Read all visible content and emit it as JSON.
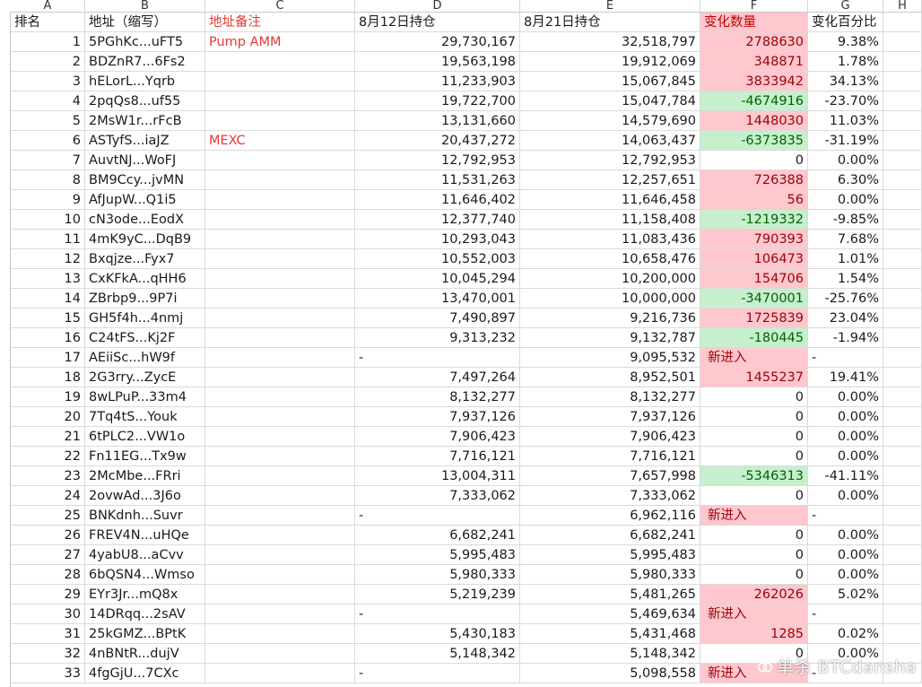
{
  "columns": [
    "A",
    "B",
    "C",
    "D",
    "E",
    "F",
    "G",
    "H"
  ],
  "headers": [
    "排名",
    "地址（缩写）",
    "地址备注",
    "8月12日持仓",
    "8月21日持仓",
    "变化数量",
    "变化百分比"
  ],
  "rows": [
    [
      "1",
      "5PGhKc...uFT5",
      "Pump AMM",
      "29,730,167",
      "32,518,797",
      "2788630",
      "9.38%",
      "pos"
    ],
    [
      "2",
      "BDZnR7...6Fs2",
      "",
      "19,563,198",
      "19,912,069",
      "348871",
      "1.78%",
      "pos"
    ],
    [
      "3",
      "hELorL...Yqrb",
      "",
      "11,233,903",
      "15,067,845",
      "3833942",
      "34.13%",
      "pos"
    ],
    [
      "4",
      "2pqQs8...uf55",
      "",
      "19,722,700",
      "15,047,784",
      "-4674916",
      "-23.70%",
      "neg"
    ],
    [
      "5",
      "2MsW1r...rFcB",
      "",
      "13,131,660",
      "14,579,690",
      "1448030",
      "11.03%",
      "pos"
    ],
    [
      "6",
      "ASTyfS...iaJZ",
      "MEXC",
      "20,437,272",
      "14,063,437",
      "-6373835",
      "-31.19%",
      "neg"
    ],
    [
      "7",
      "AuvtNJ...WoFJ",
      "",
      "12,792,953",
      "12,792,953",
      "0",
      "0.00%",
      "zero"
    ],
    [
      "8",
      "BM9Ccy...jvMN",
      "",
      "11,531,263",
      "12,257,651",
      "726388",
      "6.30%",
      "pos"
    ],
    [
      "9",
      "AfJupW...Q1i5",
      "",
      "11,646,402",
      "11,646,458",
      "56",
      "0.00%",
      "pos"
    ],
    [
      "10",
      "cN3ode...EodX",
      "",
      "12,377,740",
      "11,158,408",
      "-1219332",
      "-9.85%",
      "neg"
    ],
    [
      "11",
      "4mK9yC...DqB9",
      "",
      "10,293,043",
      "11,083,436",
      "790393",
      "7.68%",
      "pos"
    ],
    [
      "12",
      "Bxqjze...Fyx7",
      "",
      "10,552,003",
      "10,658,476",
      "106473",
      "1.01%",
      "pos"
    ],
    [
      "13",
      "CxKFkA...qHH6",
      "",
      "10,045,294",
      "10,200,000",
      "154706",
      "1.54%",
      "pos"
    ],
    [
      "14",
      "ZBrbp9...9P7i",
      "",
      "13,470,001",
      "10,000,000",
      "-3470001",
      "-25.76%",
      "neg"
    ],
    [
      "15",
      "GH5f4h...4nmj",
      "",
      "7,490,897",
      "9,216,736",
      "1725839",
      "23.04%",
      "pos"
    ],
    [
      "16",
      "C24tFS...Kj2F",
      "",
      "9,313,232",
      "9,132,787",
      "-180445",
      "-1.94%",
      "neg"
    ],
    [
      "17",
      "AEiiSc...hW9f",
      "",
      "-",
      "9,095,532",
      "新进入",
      "-",
      "new"
    ],
    [
      "18",
      "2G3rry...ZycE",
      "",
      "7,497,264",
      "8,952,501",
      "1455237",
      "19.41%",
      "pos"
    ],
    [
      "19",
      "8wLPuP...33m4",
      "",
      "8,132,277",
      "8,132,277",
      "0",
      "0.00%",
      "zero"
    ],
    [
      "20",
      "7Tq4tS...Youk",
      "",
      "7,937,126",
      "7,937,126",
      "0",
      "0.00%",
      "zero"
    ],
    [
      "21",
      "6tPLC2...VW1o",
      "",
      "7,906,423",
      "7,906,423",
      "0",
      "0.00%",
      "zero"
    ],
    [
      "22",
      "Fn11EG...Tx9w",
      "",
      "7,716,121",
      "7,716,121",
      "0",
      "0.00%",
      "zero"
    ],
    [
      "23",
      "2McMbe...FRri",
      "",
      "13,004,311",
      "7,657,998",
      "-5346313",
      "-41.11%",
      "neg"
    ],
    [
      "24",
      "2ovwAd...3J6o",
      "",
      "7,333,062",
      "7,333,062",
      "0",
      "0.00%",
      "zero"
    ],
    [
      "25",
      "BNKdnh...Suvr",
      "",
      "-",
      "6,962,116",
      "新进入",
      "-",
      "new"
    ],
    [
      "26",
      "FREV4N...uHQe",
      "",
      "6,682,241",
      "6,682,241",
      "0",
      "0.00%",
      "zero"
    ],
    [
      "27",
      "4yabU8...aCvv",
      "",
      "5,995,483",
      "5,995,483",
      "0",
      "0.00%",
      "zero"
    ],
    [
      "28",
      "6bQSN4...Wmso",
      "",
      "5,980,333",
      "5,980,333",
      "0",
      "0.00%",
      "zero"
    ],
    [
      "29",
      "EYr3Jr...mQ8x",
      "",
      "5,219,239",
      "5,481,265",
      "262026",
      "5.02%",
      "pos"
    ],
    [
      "30",
      "14DRqq...2sAV",
      "",
      "-",
      "5,469,634",
      "新进入",
      "-",
      "new"
    ],
    [
      "31",
      "25kGMZ...BPtK",
      "",
      "5,430,183",
      "5,431,468",
      "1285",
      "0.02%",
      "pos"
    ],
    [
      "32",
      "4nBNtR...dujV",
      "",
      "5,148,342",
      "5,148,342",
      "0",
      "0.00%",
      "zero"
    ],
    [
      "33",
      "4fgGjU...7CXc",
      "",
      "-",
      "5,098,558",
      "新进入",
      "-",
      "new"
    ]
  ],
  "watermark": "单杀 BTCdansha"
}
